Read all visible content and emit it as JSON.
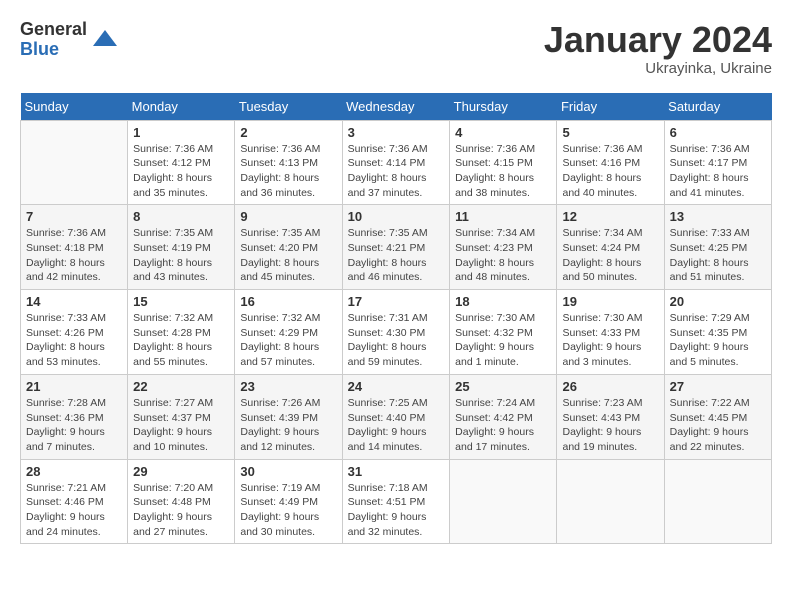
{
  "logo": {
    "general": "General",
    "blue": "Blue"
  },
  "title": "January 2024",
  "subtitle": "Ukrayinka, Ukraine",
  "weekdays": [
    "Sunday",
    "Monday",
    "Tuesday",
    "Wednesday",
    "Thursday",
    "Friday",
    "Saturday"
  ],
  "weeks": [
    [
      {
        "day": "",
        "sunrise": "",
        "sunset": "",
        "daylight": ""
      },
      {
        "day": "1",
        "sunrise": "Sunrise: 7:36 AM",
        "sunset": "Sunset: 4:12 PM",
        "daylight": "Daylight: 8 hours and 35 minutes."
      },
      {
        "day": "2",
        "sunrise": "Sunrise: 7:36 AM",
        "sunset": "Sunset: 4:13 PM",
        "daylight": "Daylight: 8 hours and 36 minutes."
      },
      {
        "day": "3",
        "sunrise": "Sunrise: 7:36 AM",
        "sunset": "Sunset: 4:14 PM",
        "daylight": "Daylight: 8 hours and 37 minutes."
      },
      {
        "day": "4",
        "sunrise": "Sunrise: 7:36 AM",
        "sunset": "Sunset: 4:15 PM",
        "daylight": "Daylight: 8 hours and 38 minutes."
      },
      {
        "day": "5",
        "sunrise": "Sunrise: 7:36 AM",
        "sunset": "Sunset: 4:16 PM",
        "daylight": "Daylight: 8 hours and 40 minutes."
      },
      {
        "day": "6",
        "sunrise": "Sunrise: 7:36 AM",
        "sunset": "Sunset: 4:17 PM",
        "daylight": "Daylight: 8 hours and 41 minutes."
      }
    ],
    [
      {
        "day": "7",
        "sunrise": "Sunrise: 7:36 AM",
        "sunset": "Sunset: 4:18 PM",
        "daylight": "Daylight: 8 hours and 42 minutes."
      },
      {
        "day": "8",
        "sunrise": "Sunrise: 7:35 AM",
        "sunset": "Sunset: 4:19 PM",
        "daylight": "Daylight: 8 hours and 43 minutes."
      },
      {
        "day": "9",
        "sunrise": "Sunrise: 7:35 AM",
        "sunset": "Sunset: 4:20 PM",
        "daylight": "Daylight: 8 hours and 45 minutes."
      },
      {
        "day": "10",
        "sunrise": "Sunrise: 7:35 AM",
        "sunset": "Sunset: 4:21 PM",
        "daylight": "Daylight: 8 hours and 46 minutes."
      },
      {
        "day": "11",
        "sunrise": "Sunrise: 7:34 AM",
        "sunset": "Sunset: 4:23 PM",
        "daylight": "Daylight: 8 hours and 48 minutes."
      },
      {
        "day": "12",
        "sunrise": "Sunrise: 7:34 AM",
        "sunset": "Sunset: 4:24 PM",
        "daylight": "Daylight: 8 hours and 50 minutes."
      },
      {
        "day": "13",
        "sunrise": "Sunrise: 7:33 AM",
        "sunset": "Sunset: 4:25 PM",
        "daylight": "Daylight: 8 hours and 51 minutes."
      }
    ],
    [
      {
        "day": "14",
        "sunrise": "Sunrise: 7:33 AM",
        "sunset": "Sunset: 4:26 PM",
        "daylight": "Daylight: 8 hours and 53 minutes."
      },
      {
        "day": "15",
        "sunrise": "Sunrise: 7:32 AM",
        "sunset": "Sunset: 4:28 PM",
        "daylight": "Daylight: 8 hours and 55 minutes."
      },
      {
        "day": "16",
        "sunrise": "Sunrise: 7:32 AM",
        "sunset": "Sunset: 4:29 PM",
        "daylight": "Daylight: 8 hours and 57 minutes."
      },
      {
        "day": "17",
        "sunrise": "Sunrise: 7:31 AM",
        "sunset": "Sunset: 4:30 PM",
        "daylight": "Daylight: 8 hours and 59 minutes."
      },
      {
        "day": "18",
        "sunrise": "Sunrise: 7:30 AM",
        "sunset": "Sunset: 4:32 PM",
        "daylight": "Daylight: 9 hours and 1 minute."
      },
      {
        "day": "19",
        "sunrise": "Sunrise: 7:30 AM",
        "sunset": "Sunset: 4:33 PM",
        "daylight": "Daylight: 9 hours and 3 minutes."
      },
      {
        "day": "20",
        "sunrise": "Sunrise: 7:29 AM",
        "sunset": "Sunset: 4:35 PM",
        "daylight": "Daylight: 9 hours and 5 minutes."
      }
    ],
    [
      {
        "day": "21",
        "sunrise": "Sunrise: 7:28 AM",
        "sunset": "Sunset: 4:36 PM",
        "daylight": "Daylight: 9 hours and 7 minutes."
      },
      {
        "day": "22",
        "sunrise": "Sunrise: 7:27 AM",
        "sunset": "Sunset: 4:37 PM",
        "daylight": "Daylight: 9 hours and 10 minutes."
      },
      {
        "day": "23",
        "sunrise": "Sunrise: 7:26 AM",
        "sunset": "Sunset: 4:39 PM",
        "daylight": "Daylight: 9 hours and 12 minutes."
      },
      {
        "day": "24",
        "sunrise": "Sunrise: 7:25 AM",
        "sunset": "Sunset: 4:40 PM",
        "daylight": "Daylight: 9 hours and 14 minutes."
      },
      {
        "day": "25",
        "sunrise": "Sunrise: 7:24 AM",
        "sunset": "Sunset: 4:42 PM",
        "daylight": "Daylight: 9 hours and 17 minutes."
      },
      {
        "day": "26",
        "sunrise": "Sunrise: 7:23 AM",
        "sunset": "Sunset: 4:43 PM",
        "daylight": "Daylight: 9 hours and 19 minutes."
      },
      {
        "day": "27",
        "sunrise": "Sunrise: 7:22 AM",
        "sunset": "Sunset: 4:45 PM",
        "daylight": "Daylight: 9 hours and 22 minutes."
      }
    ],
    [
      {
        "day": "28",
        "sunrise": "Sunrise: 7:21 AM",
        "sunset": "Sunset: 4:46 PM",
        "daylight": "Daylight: 9 hours and 24 minutes."
      },
      {
        "day": "29",
        "sunrise": "Sunrise: 7:20 AM",
        "sunset": "Sunset: 4:48 PM",
        "daylight": "Daylight: 9 hours and 27 minutes."
      },
      {
        "day": "30",
        "sunrise": "Sunrise: 7:19 AM",
        "sunset": "Sunset: 4:49 PM",
        "daylight": "Daylight: 9 hours and 30 minutes."
      },
      {
        "day": "31",
        "sunrise": "Sunrise: 7:18 AM",
        "sunset": "Sunset: 4:51 PM",
        "daylight": "Daylight: 9 hours and 32 minutes."
      },
      {
        "day": "",
        "sunrise": "",
        "sunset": "",
        "daylight": ""
      },
      {
        "day": "",
        "sunrise": "",
        "sunset": "",
        "daylight": ""
      },
      {
        "day": "",
        "sunrise": "",
        "sunset": "",
        "daylight": ""
      }
    ]
  ]
}
